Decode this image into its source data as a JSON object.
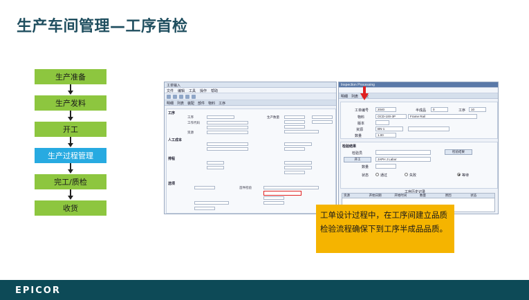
{
  "title": "生产车间管理—工序首检",
  "flow_steps": [
    {
      "label": "生产准备",
      "color": "#8dc63f"
    },
    {
      "label": "生产发料",
      "color": "#8dc63f"
    },
    {
      "label": "开工",
      "color": "#8dc63f"
    },
    {
      "label": "生产过程管理",
      "color": "#27aae1"
    },
    {
      "label": "完工/质检",
      "color": "#8dc63f"
    },
    {
      "label": "收货",
      "color": "#8dc63f"
    }
  ],
  "job_window": {
    "title": "工单输入",
    "menu": [
      "文件",
      "编辑",
      "工具",
      "操作",
      "帮助"
    ],
    "tabs": [
      "明细",
      "列表",
      "装配",
      "部件",
      "物料",
      "工序"
    ],
    "sections": {
      "operation": "工序",
      "labor": "人工成本",
      "schedule": "排程",
      "options": "选项"
    },
    "labels": {
      "op_seq": "工序",
      "op_code": "工作代码",
      "resource": "资源",
      "production_qty": "生产数量",
      "first_article": "首件检验",
      "inspection_plan": "检验计划"
    }
  },
  "inspection_window": {
    "title": "Inspection Processing",
    "tabs": [
      "明细",
      "列表",
      "批次"
    ],
    "labels": {
      "job": "工单编号",
      "assembly": "半成品",
      "op": "工序",
      "part": "物料",
      "rev": "版本",
      "resource": "资源",
      "qty": "数量",
      "inspector": "检验员",
      "result": "检验结果",
      "state": "状态",
      "pass": "通过",
      "fail": "失败",
      "pending": "等待"
    },
    "values": {
      "job": "2040",
      "assembly": "0",
      "op": "10",
      "part": "OCD-100-3P",
      "part_desc": "Frame Rail",
      "resource": "BN-1",
      "qty": "1.00",
      "inspector": "JAPH J Labor"
    },
    "buttons": {
      "inspect": "开工",
      "results": "检验结果"
    },
    "grid_title": "工序历史记录",
    "grid_headers": [
      "资源",
      "开始日期",
      "开始时间",
      "数量",
      "原因",
      "状态"
    ]
  },
  "callout": "工单设计过程中，在工序间建立品质检验流程确保下到工序半成品品质。",
  "footer_logo": "EPICOR"
}
